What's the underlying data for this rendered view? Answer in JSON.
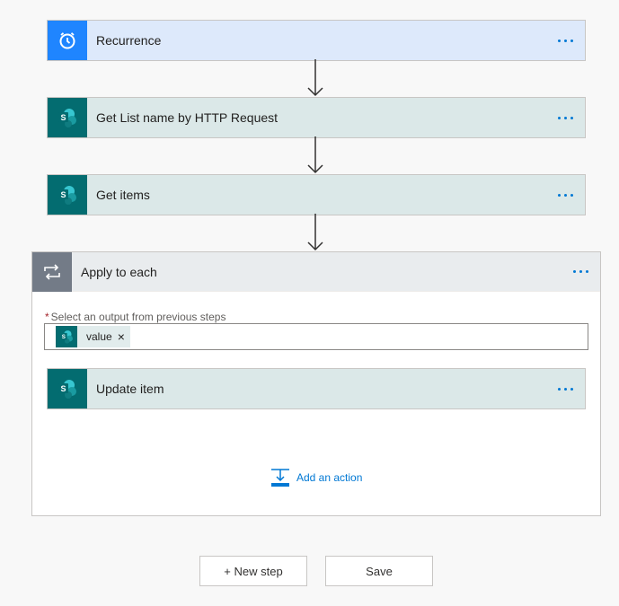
{
  "steps": [
    {
      "title": "Recurrence",
      "icon": "clock-icon"
    },
    {
      "title": "Get List name by HTTP Request",
      "icon": "sharepoint-icon"
    },
    {
      "title": "Get items",
      "icon": "sharepoint-icon"
    }
  ],
  "apply_to_each": {
    "title": "Apply to each",
    "icon": "loop-icon",
    "field_label": "Select an output from previous steps",
    "required_mark": "*",
    "token": {
      "label": "value",
      "close": "×"
    },
    "inner_step": {
      "title": "Update item",
      "icon": "sharepoint-icon"
    },
    "add_action_label": "Add an action"
  },
  "footer": {
    "new_step_label": "+ New step",
    "save_label": "Save"
  },
  "colors": {
    "recurrence_icon_bg": "#1f85ff",
    "sharepoint_icon_bg": "#036c70",
    "loop_icon_bg": "#737b87",
    "link_blue": "#0078d4"
  }
}
